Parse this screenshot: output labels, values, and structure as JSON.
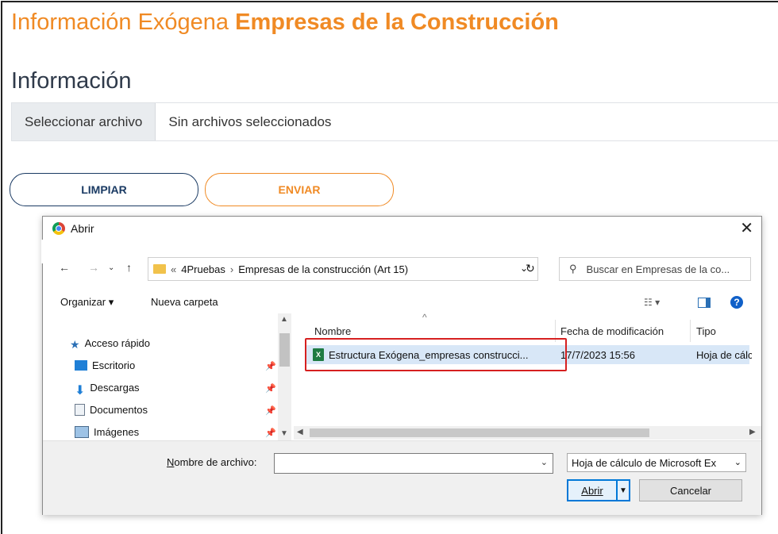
{
  "page": {
    "title_prefix": "Información Exógena",
    "title_bold": "Empresas de la Construcción",
    "section_title": "Información",
    "file_button": "Seleccionar archivo",
    "file_status": "Sin archivos seleccionados",
    "clear_button": "LIMPIAR",
    "send_button": "ENVIAR"
  },
  "dialog": {
    "title": "Abrir",
    "breadcrumb": [
      "«",
      "4Pruebas",
      "Empresas de la construcción (Art 15)"
    ],
    "search_placeholder": "Buscar en Empresas de la co...",
    "toolbar": {
      "organize": "Organizar ▾",
      "new_folder": "Nueva carpeta"
    },
    "nav_items": [
      {
        "label": "Acceso rápido",
        "icon": "star-icon"
      },
      {
        "label": "Escritorio",
        "icon": "desktop-icon"
      },
      {
        "label": "Descargas",
        "icon": "download-icon"
      },
      {
        "label": "Documentos",
        "icon": "document-icon"
      },
      {
        "label": "Imágenes",
        "icon": "image-icon"
      }
    ],
    "columns": {
      "name": "Nombre",
      "modified": "Fecha de modificación",
      "type": "Tipo"
    },
    "files": [
      {
        "name": "Estructura Exógena_empresas construcci...",
        "modified": "17/7/2023 15:56",
        "type": "Hoja de cálcu"
      }
    ],
    "filename_label_underlined": "N",
    "filename_label_rest": "ombre de archivo:",
    "filename_value": "",
    "filter": "Hoja de cálculo de Microsoft Ex",
    "open_button_underlined": "A",
    "open_button_rest": "brir",
    "cancel_button": "Cancelar"
  },
  "colors": {
    "accent_orange": "#f08a24",
    "navy": "#1a3a63",
    "highlight_red": "#d62020"
  }
}
